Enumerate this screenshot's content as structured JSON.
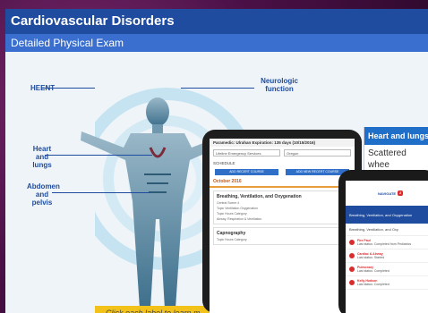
{
  "slide": {
    "title": "Cardiovascular Disorders",
    "subtitle": "Detailed Physical Exam",
    "labels": {
      "heent": "HEENT",
      "neurologic": "Neurologic function",
      "heart": "Heart and lungs",
      "abdomen": "Abdomen and pelvis"
    },
    "heart_panel": {
      "title": "Heart and lungs",
      "text": "Scattered whee crackles, breat"
    },
    "instruction": "Click each label to learn m"
  },
  "tablet": {
    "header": "Paramedic: Ulrahan Expiration: 135 days (10/15/2016)",
    "select_left": "Lifeline Emergency Services",
    "select_right": "Oregon",
    "schedule_label": "SCHEDULE",
    "btn_left": "ADD RECERT COURSE",
    "btn_right": "ADD NEW RECERT COURSE",
    "date": "October 2016",
    "card1": {
      "title": "Breathing, Ventilation, and Oxygenation",
      "line1": "Central Scene 4",
      "line2": "Topic Ventilation Oxygenation",
      "line3": "Airway, Respiration & Ventilation",
      "line4": "Topic      Hours      Category"
    },
    "card2": {
      "title": "Capnography",
      "line1": "Topic      Hours      Category"
    }
  },
  "phone": {
    "app_name": "NAVIGATE",
    "badge": "2",
    "banner": "Breathing, Ventilation, and Oxygenation",
    "section": "Breathing, Ventilation, and Oxy",
    "items": [
      {
        "title": "Fire Paul",
        "detail": "Last status: Completed from Pediatrics"
      },
      {
        "title": "Cardiac & Airway",
        "detail": "Last status: Started"
      },
      {
        "title": "Pulmonary",
        "detail": "Last status: Completed"
      },
      {
        "title": "Kelly Hudson",
        "detail": "Last status: Completed"
      }
    ]
  },
  "colors": {
    "title_bar": "#1f4c9e",
    "sub_bar": "#3a6fd0",
    "accent_yellow": "#f3c21a",
    "alert_red": "#d92d2d"
  }
}
